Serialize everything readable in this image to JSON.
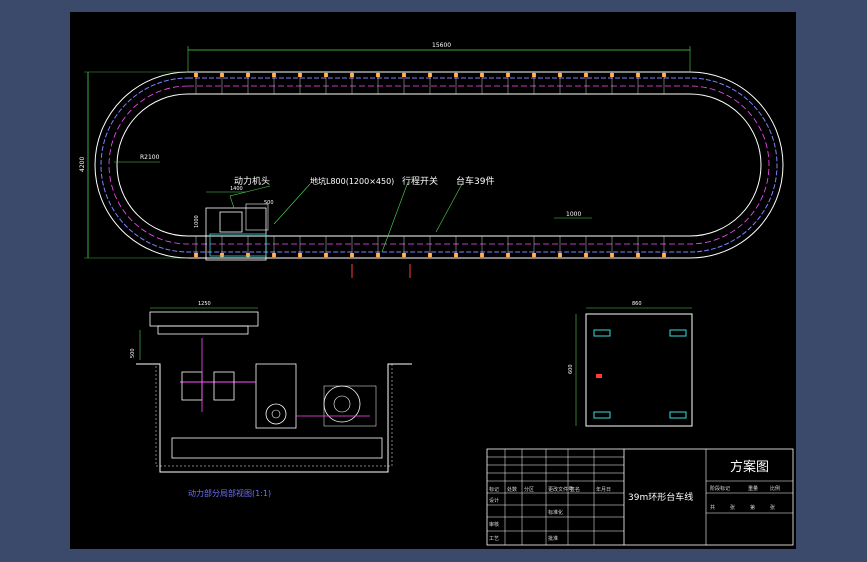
{
  "colors": {
    "background": "#3b4a6b",
    "sheet": "#000000",
    "outline": "#ffffff",
    "dimension": "#4fd84f",
    "track": "#7f7fff",
    "accent": "#ff3b3b",
    "magenta": "#ff4fff",
    "carrier": "#ff9f2f",
    "cyan": "#33dddd"
  },
  "icons": [
    "mechanical-drawing"
  ],
  "dimensions": {
    "overall_length": "15600",
    "overall_height": "4200",
    "radius": "R2100",
    "drive_width": "1400",
    "segment": "1000",
    "drive_small": "500",
    "drive_side": "1000",
    "pit_width": "1250",
    "pit_height": "500",
    "plate_width": "860",
    "plate_height": "600"
  },
  "callouts": {
    "drive_head": "动力机头",
    "pit": "地坑L800(1200×450)",
    "travel_switch": "行程开关",
    "carts": "台车39件"
  },
  "section_caption": "动力部分局部视图(1:1)",
  "title_block": {
    "drawing_type": "方案图",
    "project_name": "39m环形台车线",
    "row1": [
      "标记",
      "处数",
      "分区",
      "更改文件号",
      "签名",
      "年月日"
    ],
    "row2": [
      "设计",
      "",
      "",
      "标准化"
    ],
    "row3": [
      "审核",
      "",
      "",
      ""
    ],
    "row4": [
      "工艺",
      "",
      "",
      "批准"
    ],
    "scale_labels": [
      "阶段标记",
      "重量",
      "比例"
    ],
    "sheet_labels": [
      "共",
      "张",
      "第",
      "张"
    ]
  }
}
